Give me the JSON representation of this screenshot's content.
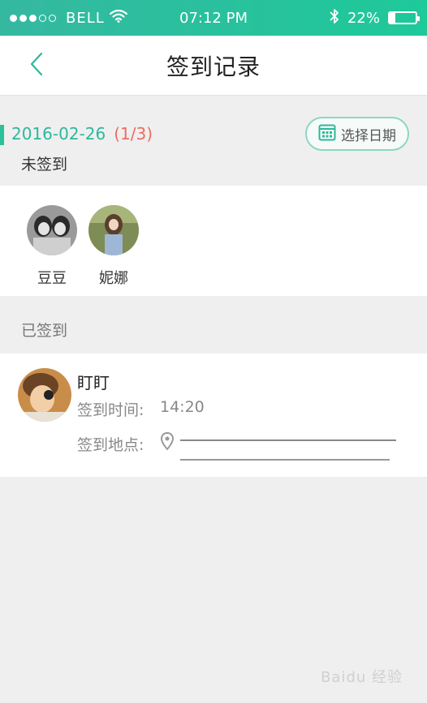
{
  "status_bar": {
    "carrier": "BELL",
    "time": "07:12 PM",
    "battery_percent": "22%",
    "battery_level": 0.22,
    "signal_filled": 3,
    "signal_total": 5,
    "icons": [
      "wifi-icon",
      "bluetooth-icon",
      "battery-icon"
    ]
  },
  "nav": {
    "title": "签到记录",
    "back_icon": "chevron-left-icon"
  },
  "date": {
    "value": "2016-02-26",
    "count": "(1/3)",
    "pick_label": "选择日期",
    "pick_icon": "calendar-icon"
  },
  "unsigned": {
    "label": "未签到",
    "people": [
      {
        "name": "豆豆"
      },
      {
        "name": "妮娜"
      }
    ]
  },
  "signed": {
    "label": "已签到",
    "records": [
      {
        "name": "盯盯",
        "time_label": "签到时间:",
        "time_value": "14:20",
        "location_label": "签到地点:"
      }
    ]
  },
  "watermark": "Baidu 经验",
  "colors": {
    "accent": "#2cb89c",
    "count_red": "#ef6b60",
    "status_bar": "#1ec99a"
  }
}
